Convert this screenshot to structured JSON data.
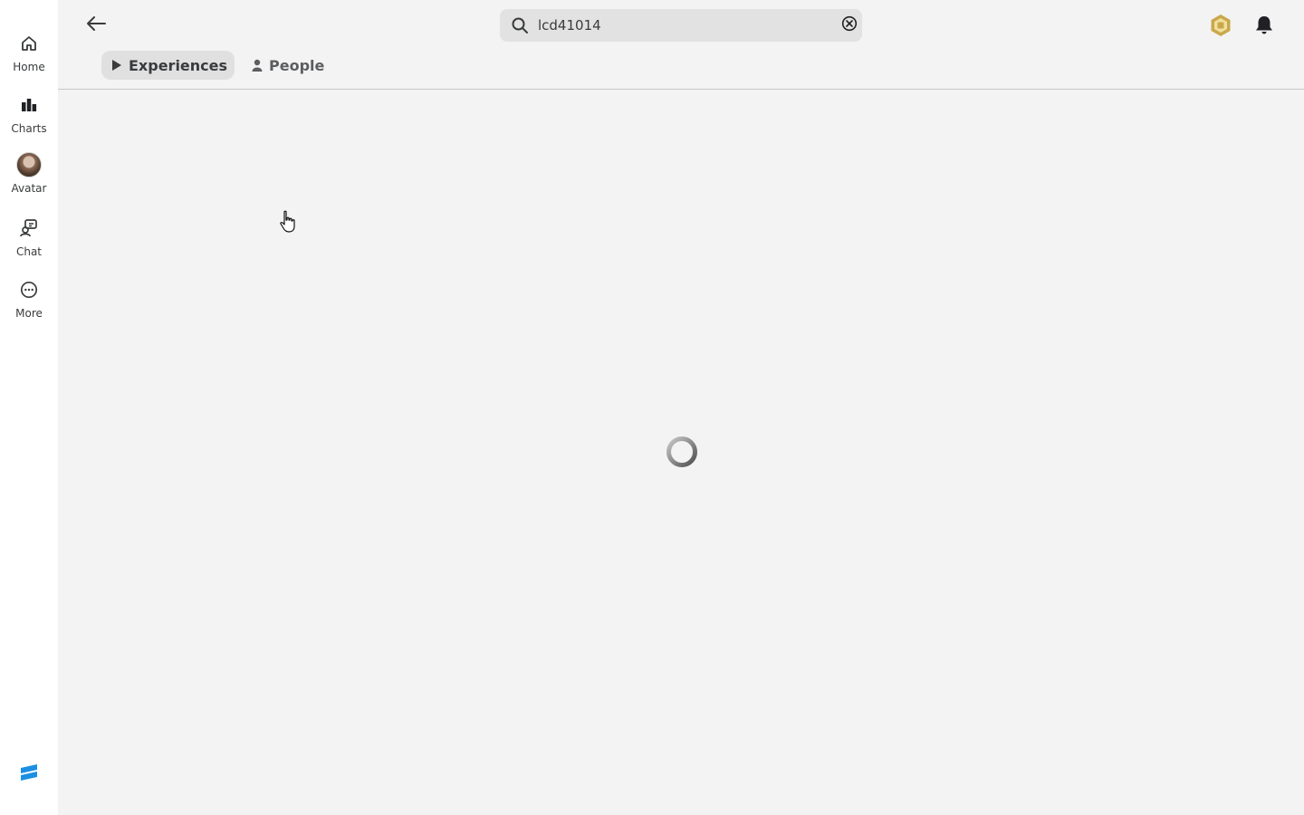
{
  "sidebar": {
    "items": [
      {
        "label": "Home",
        "icon": "home-icon"
      },
      {
        "label": "Charts",
        "icon": "charts-icon"
      },
      {
        "label": "Avatar",
        "icon": "avatar-icon"
      },
      {
        "label": "Chat",
        "icon": "chat-icon"
      },
      {
        "label": "More",
        "icon": "more-icon"
      }
    ],
    "footer_icon": "roblox-studio-logo"
  },
  "header": {
    "back_icon": "back-arrow-icon",
    "search": {
      "value": "lcd41014",
      "placeholder": "Search",
      "icon": "search-icon",
      "clear_icon": "clear-icon"
    },
    "robux_icon": "robux-icon",
    "notifications_icon": "bell-icon"
  },
  "tabs": [
    {
      "label": "Experiences",
      "icon": "play-icon",
      "active": true
    },
    {
      "label": "People",
      "icon": "person-icon",
      "active": false
    }
  ],
  "main": {
    "state": "loading",
    "spinner_icon": "loading-spinner"
  },
  "colors": {
    "background": "#f3f3f3",
    "sidebar": "#ffffff",
    "search_bg": "#e2e2e2",
    "robux_gold": "#c9a84c",
    "studio_blue": "#1a8fe3"
  }
}
